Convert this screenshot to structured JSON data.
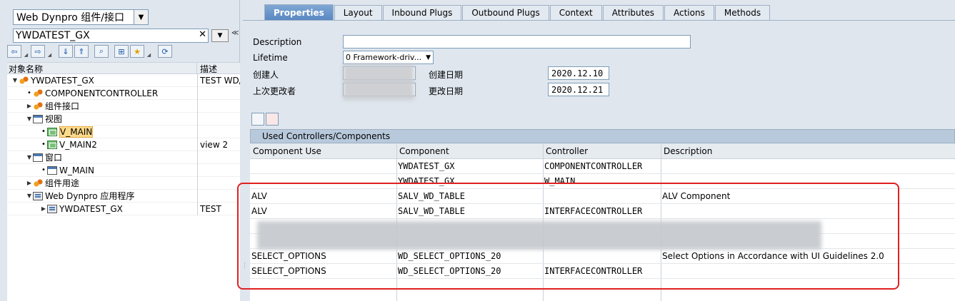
{
  "left": {
    "object_type": "Web Dynpro 组件/接口",
    "object_name": "YWDATEST_GX",
    "clear_symbol": "✕",
    "tree_header": {
      "name": "对象名称",
      "desc": "描述"
    },
    "tree": [
      {
        "label": "YWDATEST_GX",
        "desc": "TEST WD/",
        "toggle": "▼",
        "icon": "comp",
        "indent": 0
      },
      {
        "label": "COMPONENTCONTROLLER",
        "desc": "",
        "toggle": "•",
        "icon": "comp",
        "indent": 1
      },
      {
        "label": "组件接口",
        "desc": "",
        "toggle": "▶",
        "icon": "comp",
        "indent": 1
      },
      {
        "label": "视图",
        "desc": "",
        "toggle": "▼",
        "icon": "win",
        "indent": 1
      },
      {
        "label": "V_MAIN",
        "desc": "",
        "toggle": "•",
        "icon": "view",
        "indent": 2,
        "selected": true
      },
      {
        "label": "V_MAIN2",
        "desc": "view 2",
        "toggle": "•",
        "icon": "view",
        "indent": 2
      },
      {
        "label": "窗口",
        "desc": "",
        "toggle": "▼",
        "icon": "win",
        "indent": 1
      },
      {
        "label": "W_MAIN",
        "desc": "",
        "toggle": "•",
        "icon": "win",
        "indent": 2
      },
      {
        "label": "组件用途",
        "desc": "",
        "toggle": "▶",
        "icon": "comp",
        "indent": 1
      },
      {
        "label": "Web Dynpro 应用程序",
        "desc": "",
        "toggle": "▼",
        "icon": "app",
        "indent": 1
      },
      {
        "label": "YWDATEST_GX",
        "desc": "TEST",
        "toggle": "▶",
        "icon": "app",
        "indent": 2
      }
    ]
  },
  "tabs": [
    {
      "label": "Properties",
      "active": true
    },
    {
      "label": "Layout"
    },
    {
      "label": "Inbound Plugs"
    },
    {
      "label": "Outbound Plugs"
    },
    {
      "label": "Context"
    },
    {
      "label": "Attributes"
    },
    {
      "label": "Actions"
    },
    {
      "label": "Methods"
    }
  ],
  "props": {
    "description_label": "Description",
    "description_value": "",
    "lifetime_label": "Lifetime",
    "lifetime_value": "0 Framework-driv...",
    "created_by_label": "创建人",
    "changed_by_label": "上次更改者",
    "created_on_label": "创建日期",
    "created_on_value": "2020.12.10",
    "changed_on_label": "更改日期",
    "changed_on_value": "2020.12.21"
  },
  "grid": {
    "title": "Used Controllers/Components",
    "columns": [
      "Component Use",
      "Component",
      "Controller",
      "Description"
    ],
    "rows": [
      [
        "",
        "YWDATEST_GX",
        "COMPONENTCONTROLLER",
        ""
      ],
      [
        "",
        "YWDATEST_GX",
        "W_MAIN",
        ""
      ],
      [
        "ALV",
        "SALV_WD_TABLE",
        "",
        "ALV Component"
      ],
      [
        "ALV",
        "SALV_WD_TABLE",
        "INTERFACECONTROLLER",
        ""
      ],
      [
        "",
        "",
        "",
        ""
      ],
      [
        "",
        "",
        "",
        ""
      ],
      [
        "SELECT_OPTIONS",
        "WD_SELECT_OPTIONS_20",
        "",
        "Select Options in Accordance with UI Guidelines 2.0"
      ],
      [
        "SELECT_OPTIONS",
        "WD_SELECT_OPTIONS_20",
        "INTERFACECONTROLLER",
        ""
      ]
    ]
  },
  "colors": {
    "highlight_box": "#e02020",
    "active_tab": "#5a88c2",
    "selected_row": "#fcda8a"
  }
}
